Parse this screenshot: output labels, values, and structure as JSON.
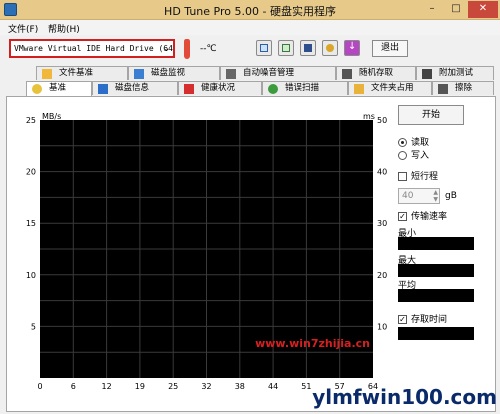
{
  "window": {
    "title": "HD Tune Pro 5.00 - 硬盘实用程序",
    "minimize": "–",
    "maximize": "□",
    "close": "✕"
  },
  "menu": {
    "file": "文件(F)",
    "help": "帮助(H)"
  },
  "toolbar": {
    "drive_value": "VMware Virtual IDE Hard Drive (64",
    "temperature": "--℃",
    "exit_label": "退出"
  },
  "tabs_row1": [
    "文件基准",
    "磁盘监视",
    "自动噪音管理",
    "随机存取",
    "附加测试"
  ],
  "tabs_row2": [
    "基准",
    "磁盘信息",
    "健康状况",
    "错误扫描",
    "文件夹占用",
    "擦除"
  ],
  "side": {
    "start_label": "开始",
    "read_label": "读取",
    "write_label": "写入",
    "short_stroke_label": "短行程",
    "short_stroke_value": "40",
    "short_stroke_unit": "gB",
    "transfer_rate_label": "传输速率",
    "min_label": "最小",
    "max_label": "最大",
    "avg_label": "平均",
    "access_time_label": "存取时间",
    "check_mark": "✓"
  },
  "chart_data": {
    "type": "line",
    "left_unit": "MB/s",
    "right_unit": "ms",
    "left_ticks": [
      "25",
      "20",
      "15",
      "10",
      "5"
    ],
    "right_ticks": [
      "50",
      "40",
      "30",
      "20",
      "10"
    ],
    "x_ticks": [
      "0",
      "6",
      "12",
      "19",
      "25",
      "32",
      "38",
      "44",
      "51",
      "57",
      "64"
    ],
    "left_ylim": [
      0,
      25
    ],
    "right_ylim": [
      0,
      50
    ],
    "grid": true,
    "series": []
  },
  "watermarks": [
    "www.win7zhijia.cn",
    "ylmfwin100.com"
  ],
  "colors": {
    "titlebar": "#e7ca8a",
    "chart_bg": "#000000",
    "grid": "#3a3a3a",
    "drive_border": "#d11f1f"
  }
}
